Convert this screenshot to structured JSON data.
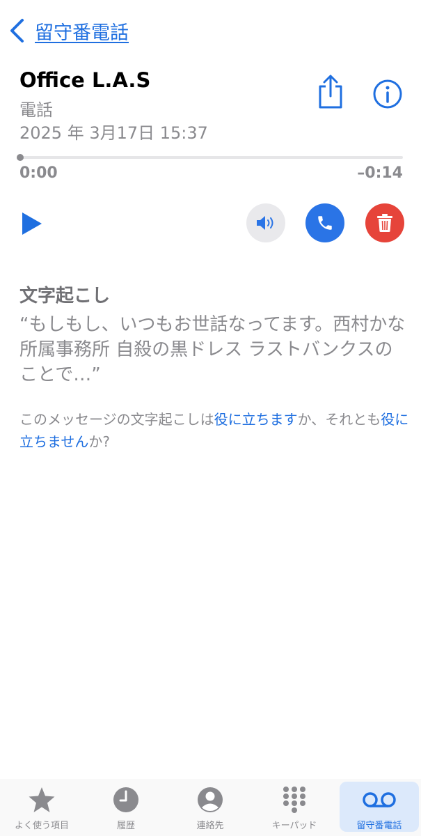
{
  "nav": {
    "back_label": "留守番電話"
  },
  "message": {
    "caller": "Office L.A.S",
    "type": "電話",
    "date": "2025 年 3月17日 15:37"
  },
  "playback": {
    "elapsed": "0:00",
    "remaining": "–0:14",
    "progress": 0
  },
  "transcript": {
    "heading": "文字起こし",
    "text": "“もしもし、いつもお世話なってます。西村かな所属事務所 自殺の黒ドレス ラストバンクスのことで…”"
  },
  "feedback": {
    "prefix": "このメッセージの文字起こしは",
    "helpful": "役に立ちます",
    "middle": "か、それとも",
    "not_helpful": "役に立ちません",
    "suffix": "か?"
  },
  "tabs": {
    "favorites": "よく使う項目",
    "recents": "履歴",
    "contacts": "連絡先",
    "keypad": "キーパッド",
    "voicemail": "留守番電話"
  },
  "colors": {
    "accent": "#1f6fe0",
    "call": "#2a74e6",
    "delete": "#e6443a",
    "muted": "#8a8a8e",
    "active_tab_bg": "#dce9fb"
  }
}
